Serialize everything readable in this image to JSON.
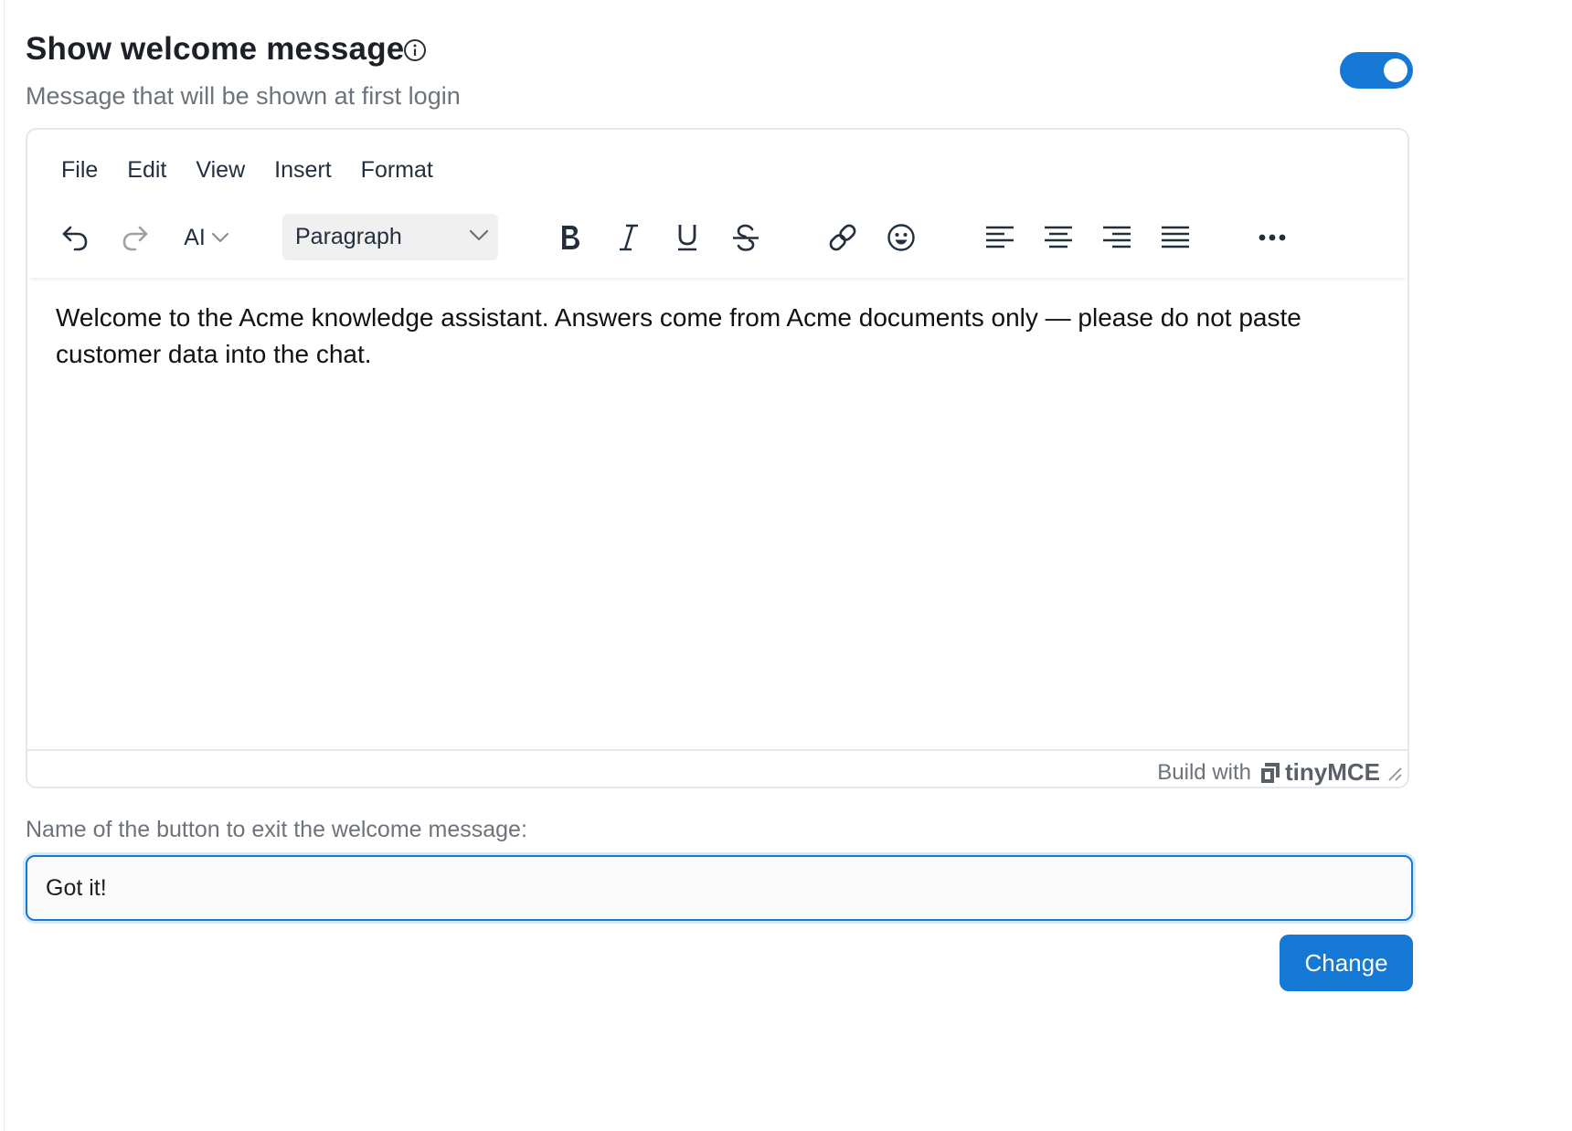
{
  "header": {
    "title": "Show welcome message",
    "subtitle": "Message that will be shown at first login",
    "toggle_on": true
  },
  "editor": {
    "menu": [
      "File",
      "Edit",
      "View",
      "Insert",
      "Format"
    ],
    "toolbar": {
      "ai_label": "AI",
      "block_format": "Paragraph",
      "icons": [
        "undo-icon",
        "redo-icon",
        "ai-dropdown",
        "bold-icon",
        "italic-icon",
        "underline-icon",
        "strikethrough-icon",
        "link-icon",
        "emoji-icon",
        "align-left-icon",
        "align-center-icon",
        "align-right-icon",
        "align-justify-icon",
        "more-icon"
      ]
    },
    "content": "Welcome to the Acme knowledge assistant. Answers come from Acme documents only — please do not paste customer data into the chat.",
    "status": {
      "brand_text": "Build with",
      "brand_name": "tinyMCE"
    }
  },
  "exit_button_field": {
    "label": "Name of the button to exit the welcome message:",
    "value": "Got it!"
  },
  "change_button": "Change",
  "colors": {
    "accent": "#1478d4",
    "muted_text": "#6d737a",
    "toolbar_icon": "#222f3e"
  }
}
